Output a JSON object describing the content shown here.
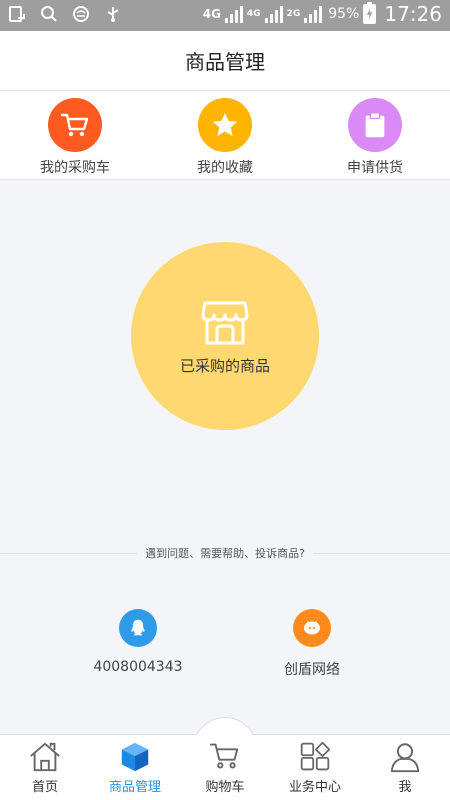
{
  "status_bar": {
    "network_1": "4G",
    "network_2": "4G",
    "network_3": "2G",
    "battery": "95%",
    "time": "17:26"
  },
  "header": {
    "title": "商品管理"
  },
  "quick_actions": [
    {
      "label": "我的采购车",
      "icon": "cart-icon",
      "color": "#ff5a1f"
    },
    {
      "label": "我的收藏",
      "icon": "star-icon",
      "color": "#ffb400"
    },
    {
      "label": "申请供货",
      "icon": "clipboard-icon",
      "color": "#d98af5"
    }
  ],
  "main": {
    "purchased_label": "已采购的商品",
    "circle_color": "#ffd970",
    "help_text": "遇到问题、需要帮助、投诉商品?"
  },
  "contacts": [
    {
      "label": "4008004343",
      "icon": "qq-icon",
      "color": "#2f9be8"
    },
    {
      "label": "创盾网络",
      "icon": "mascot-icon",
      "color": "#ff8a1c"
    }
  ],
  "tabbar": {
    "items": [
      {
        "label": "首页",
        "icon": "home-icon"
      },
      {
        "label": "商品管理",
        "icon": "box-icon"
      },
      {
        "label": "购物车",
        "icon": "cart-icon"
      },
      {
        "label": "业务中心",
        "icon": "grid-icon"
      },
      {
        "label": "我",
        "icon": "user-icon"
      }
    ],
    "active_color": "#2196f3"
  }
}
